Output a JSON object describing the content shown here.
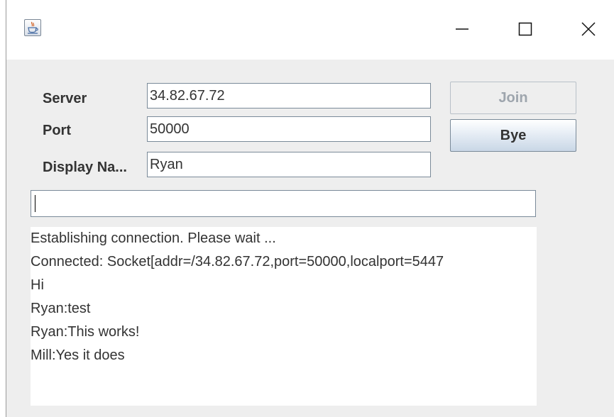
{
  "window": {
    "title": "",
    "icon": "java-coffee-cup-icon",
    "controls": {
      "minimize": "minimize-icon",
      "maximize": "maximize-icon",
      "close": "close-icon"
    }
  },
  "form": {
    "server_label": "Server",
    "server_value": "34.82.67.72",
    "port_label": "Port",
    "port_value": "50000",
    "display_name_label": "Display Na...",
    "display_name_value": "Ryan"
  },
  "buttons": {
    "join_label": "Join",
    "join_enabled": false,
    "bye_label": "Bye",
    "bye_enabled": true
  },
  "message_input": {
    "value": ""
  },
  "chat_log": {
    "lines": [
      "Establishing connection. Please wait ...",
      "Connected: Socket[addr=/34.82.67.72,port=50000,localport=5447",
      "Hi",
      "Ryan:test",
      "Ryan:This works!",
      "Mill:Yes it does"
    ]
  },
  "colors": {
    "window_bg": "#eeeeee",
    "titlebar_bg": "#ffffff",
    "text": "#333333",
    "disabled_text": "#9ea5ad",
    "field_border": "#7a8a99"
  }
}
